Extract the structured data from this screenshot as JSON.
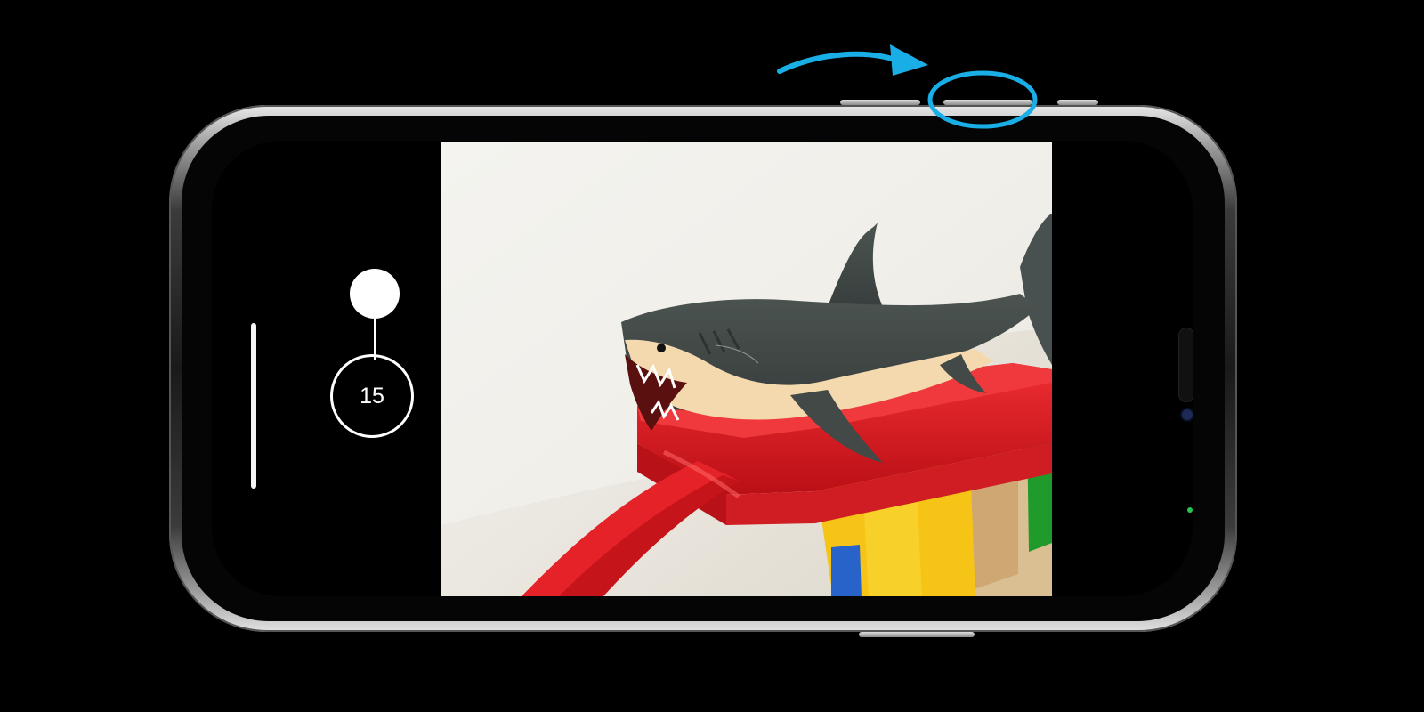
{
  "camera": {
    "burst_count": "15",
    "accent_color": "#1aaee6"
  },
  "icons": {
    "annotation_arrow": "curved-arrow-icon",
    "button_highlight": "highlight-ellipse-icon"
  }
}
